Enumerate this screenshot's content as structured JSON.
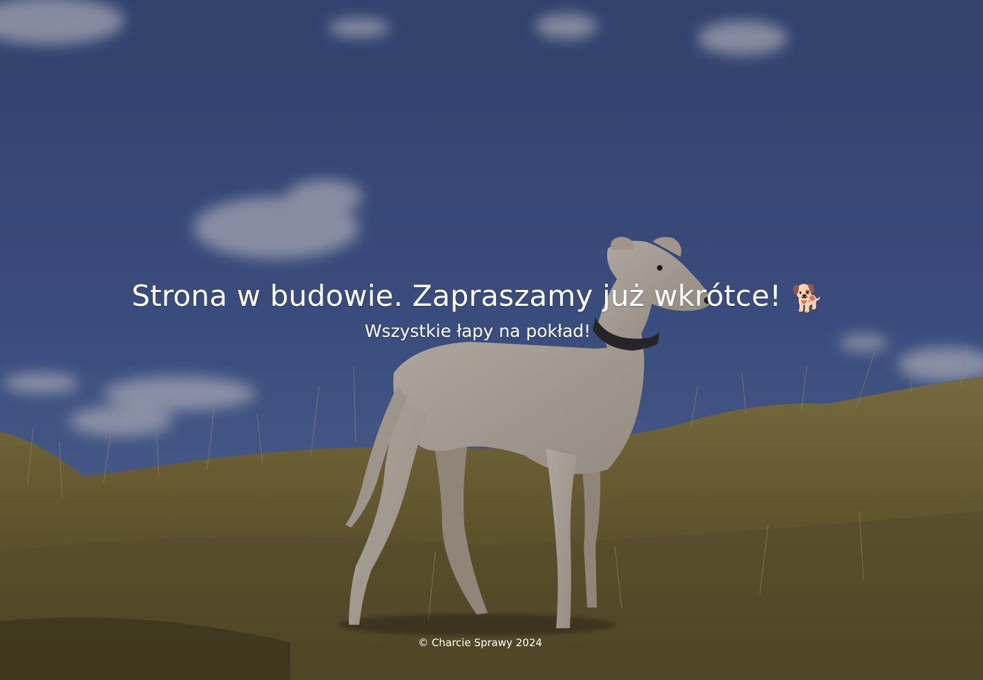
{
  "background": {
    "image": "greyhound-dog-on-grassy-hill-under-blue-sky",
    "sky_color": "#4a64a6",
    "grass_color": "#8a7a3e",
    "overlay_color": "#14161e"
  },
  "hero": {
    "headline": "Strona w budowie. Zapraszamy już wkrótce!",
    "headline_icon": "🐕",
    "tagline": "Wszystkie łapy na pokład!"
  },
  "footer": {
    "copyright": "© Charcie Sprawy 2024"
  }
}
